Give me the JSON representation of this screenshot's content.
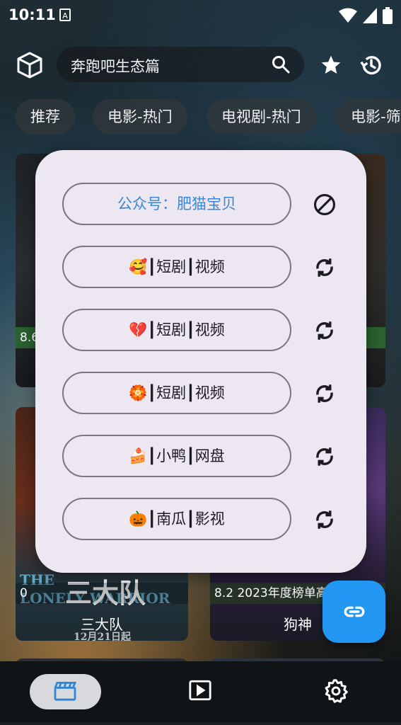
{
  "status_bar": {
    "time": "10:11",
    "notification_glyph": "A"
  },
  "header": {
    "search_text": "奔跑吧生态篇"
  },
  "tabs": [
    "推荐",
    "电影-热门",
    "电视剧-热门",
    "电影-筛"
  ],
  "cards": [
    {
      "score": "8.6",
      "title": ""
    },
    {
      "score": "",
      "title": ""
    },
    {
      "score": "0",
      "title": "三大队",
      "poster_lines": [
        "THE",
        "LONELY WARRIOR",
        "三大队",
        "12月21日起"
      ]
    },
    {
      "score": "8.2 2023年度榜单高",
      "title": "狗神"
    }
  ],
  "dialog": {
    "sources": [
      {
        "label": "公众号：肥猫宝贝",
        "icon": "block-icon",
        "active": true
      },
      {
        "label": "🥰┃短剧┃视频",
        "icon": "sync-icon",
        "active": false
      },
      {
        "label": "💔┃短剧┃视频",
        "icon": "sync-icon",
        "active": false
      },
      {
        "label": "🏵️┃短剧┃视频",
        "icon": "sync-icon",
        "active": false
      },
      {
        "label": "🍰┃小鸭┃网盘",
        "icon": "sync-icon",
        "active": false
      },
      {
        "label": "🎃┃南瓜┃影视",
        "icon": "sync-icon",
        "active": false
      }
    ]
  },
  "colors": {
    "accent": "#2196f3",
    "dialog_bg": "#ede7f1",
    "active_text": "#3b86d4"
  }
}
